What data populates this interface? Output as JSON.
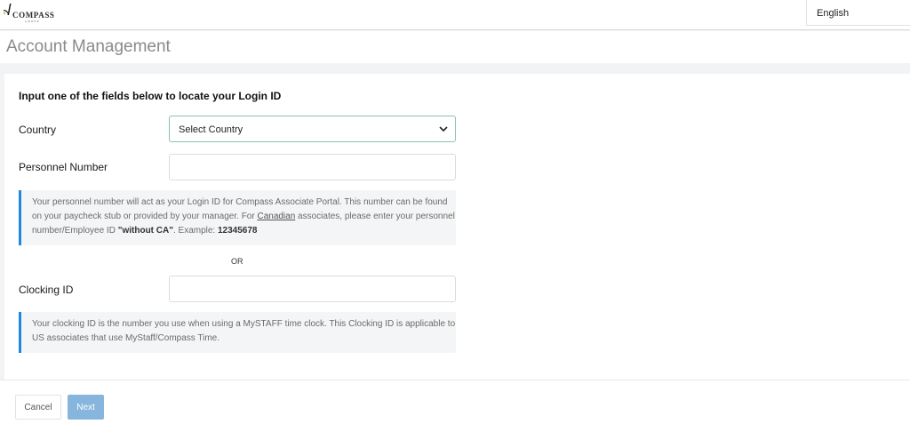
{
  "header": {
    "logo_text": "COMPASS",
    "logo_sub": "GROUP",
    "language": "English"
  },
  "page": {
    "title": "Account Management"
  },
  "form": {
    "heading": "Input one of the fields below to locate your Login ID",
    "country_label": "Country",
    "country_selected": "Select Country",
    "personnel_label": "Personnel Number",
    "personnel_value": "",
    "personnel_info_part1": "Your personnel number will act as your Login ID for Compass Associate Portal. This number can be found on your paycheck stub or provided by your manager. For ",
    "personnel_info_link": "Canadian",
    "personnel_info_part2": " associates, please enter your personnel number/Employee ID ",
    "personnel_info_bold": "\"without CA\"",
    "personnel_info_part3": ". Example: ",
    "personnel_info_example": "12345678",
    "or_text": "OR",
    "clocking_label": "Clocking ID",
    "clocking_value": "",
    "clocking_info": "Your clocking ID is the number you use when using a MySTAFF time clock. This Clocking ID is applicable to US associates that use MyStaff/Compass Time."
  },
  "footer": {
    "cancel_label": "Cancel",
    "next_label": "Next"
  },
  "colors": {
    "accent": "#1e88e5",
    "next_button": "#86b5dd",
    "select_border": "#8dc2ad"
  }
}
